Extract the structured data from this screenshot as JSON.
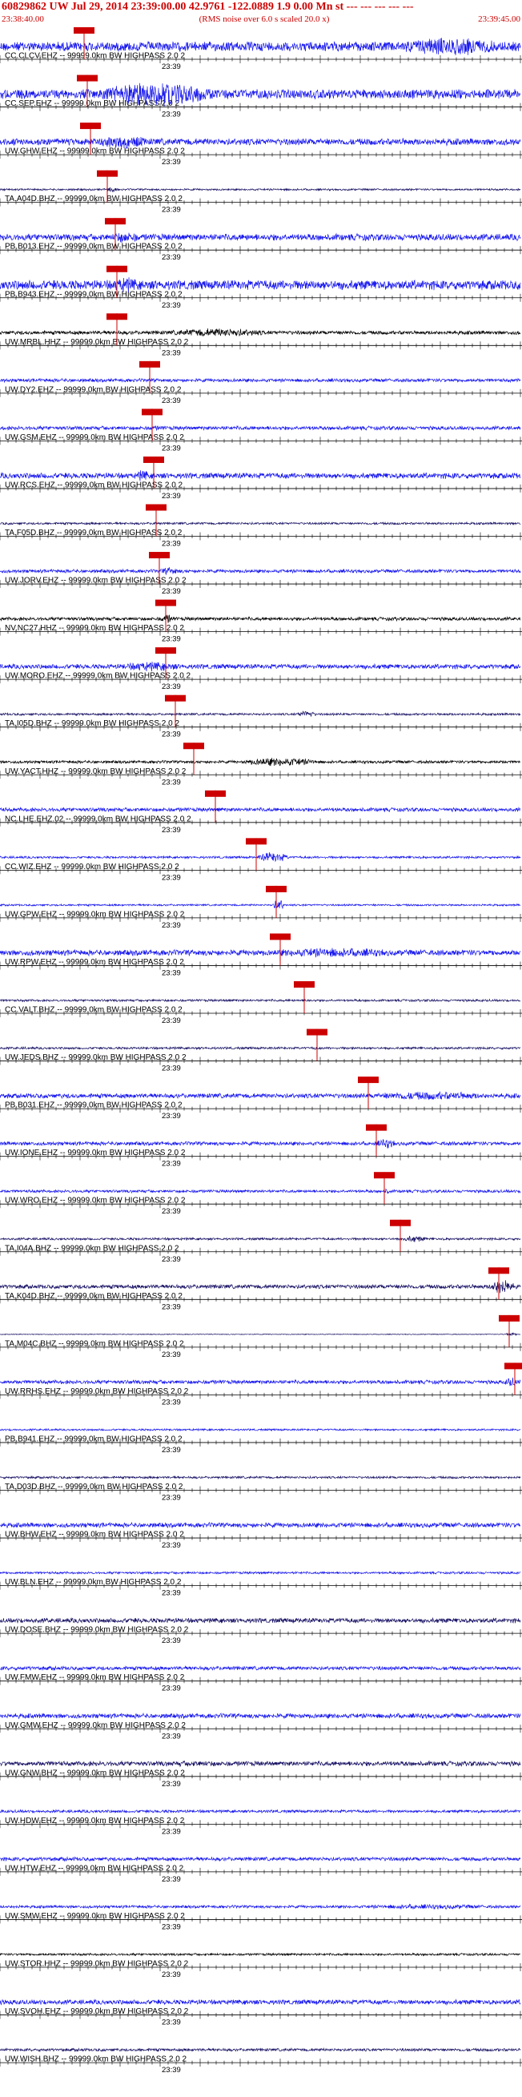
{
  "header": {
    "title": "60829862 UW Jul 29, 2014 23:39:00.00   42.9761 -122.0889  1.9 0.00 Mn st --- --- --- --- ---",
    "subtitle": "(RMS noise over 6.0 s scaled 20.0 x)",
    "start_time": "23:38:40.00",
    "end_time": "23:39:45.00"
  },
  "tick_label": "23:39",
  "colors": {
    "title": "#cc0000",
    "blue_trace": "#1a1aee",
    "navy_trace": "#1a1466",
    "black_trace": "#000000",
    "pick_box": "#cc0000",
    "axis": "#000000"
  },
  "chart_data": {
    "type": "seismogram",
    "x_unit": "time (UTC)",
    "xlim": [
      "23:38:40.00",
      "23:39:45.00"
    ],
    "channels": [
      {
        "label": "CC.CLCV.EHZ -- 99999.0km BW  HIGHPASS  2.0  2",
        "color": "blue",
        "pick": "23:38:50.5",
        "amp": 0.5,
        "burst": {
          "s": "23:39:30",
          "e": "23:39:45",
          "a": 0.95
        }
      },
      {
        "label": "CC.SEP.EHZ -- 99999.0km BW  HIGHPASS  2.0  2",
        "color": "blue",
        "pick": "23:38:50.9",
        "amp": 0.5,
        "burst": {
          "s": "23:38:52",
          "e": "23:39:10",
          "a": 1.3
        }
      },
      {
        "label": "UW.GHW.EHZ -- 99999.0km BW  HIGHPASS  2.0  2",
        "color": "blue",
        "pick": "23:38:51.3",
        "amp": 0.35,
        "burst": {
          "s": "23:38:52",
          "e": "23:39:00",
          "a": 0.7
        }
      },
      {
        "label": "TA.A04D.BHZ -- 99999.0km BW  HIGHPASS  2.0  2",
        "color": "navy",
        "pick": "23:38:53.4",
        "amp": 0.1,
        "burst": {
          "s": "23:38:53",
          "e": "23:38:55",
          "a": 0.3
        }
      },
      {
        "label": "PB.B013.EHZ -- 99999.0km BW  HIGHPASS  2.0  2",
        "color": "blue",
        "pick": "23:38:54.4",
        "amp": 0.35,
        "burst": {
          "s": "23:38:54",
          "e": "23:38:58",
          "a": 0.6
        }
      },
      {
        "label": "PB.B943.EHZ -- 99999.0km BW  HIGHPASS  2.0  2",
        "color": "blue",
        "pick": "23:38:54.6",
        "amp": 0.5,
        "burst": {
          "s": "23:38:54",
          "e": "23:38:58",
          "a": 0.8
        }
      },
      {
        "label": "UW.MRBL.HHZ -- 99999.0km BW  HIGHPASS  2.0  2",
        "color": "black",
        "pick": "23:38:54.6",
        "amp": 0.2,
        "burst": {
          "s": "23:39:01",
          "e": "23:39:16",
          "a": 0.45
        }
      },
      {
        "label": "UW.DY2.EHZ -- 99999.0km BW  HIGHPASS  2.0  2",
        "color": "blue",
        "pick": "23:38:58.7",
        "amp": 0.18,
        "burst": {
          "s": "23:38:59",
          "e": "23:39:00",
          "a": 0.2
        }
      },
      {
        "label": "UW.GSM.EHZ -- 99999.0km BW  HIGHPASS  2.0  2",
        "color": "blue",
        "pick": "23:38:59.0",
        "amp": 0.2,
        "burst": {
          "s": "23:38:59",
          "e": "23:39:01",
          "a": 0.25
        }
      },
      {
        "label": "UW.RCS.EHZ -- 99999.0km BW  HIGHPASS  2.0  2",
        "color": "blue",
        "pick": "23:38:59.2",
        "amp": 0.3,
        "burst": {
          "s": "23:38:57",
          "e": "23:38:59",
          "a": 0.6
        }
      },
      {
        "label": "TA.F05D.BHZ -- 99999.0km BW  HIGHPASS  2.0  2",
        "color": "navy",
        "pick": "23:38:59.5",
        "amp": 0.12,
        "burst": {
          "s": "23:38:59",
          "e": "23:39:00",
          "a": 0.2
        }
      },
      {
        "label": "UW.JORV.EHZ -- 99999.0km BW  HIGHPASS  2.0  2",
        "color": "blue",
        "pick": "23:38:59.9",
        "amp": 0.18,
        "burst": {
          "s": "23:39:00",
          "e": "23:39:03",
          "a": 0.4
        }
      },
      {
        "label": "NV.NC27.HHZ -- 99999.0km BW  HIGHPASS  2.0  2",
        "color": "black",
        "pick": "23:39:00.7",
        "amp": 0.18,
        "burst": {
          "s": "23:39:00",
          "e": "23:39:02",
          "a": 0.5
        }
      },
      {
        "label": "UW.MORO.EHZ -- 99999.0km BW  HIGHPASS  2.0  2",
        "color": "blue",
        "pick": "23:39:00.7",
        "amp": 0.25,
        "burst": {
          "s": "23:38:55",
          "e": "23:39:04",
          "a": 0.5
        }
      },
      {
        "label": "TA.I05D.BHZ -- 99999.0km BW  HIGHPASS  2.0  2",
        "color": "navy",
        "pick": "23:39:01.9",
        "amp": 0.12,
        "burst": {
          "s": "23:39:17",
          "e": "23:39:20",
          "a": 0.4
        }
      },
      {
        "label": "UW.YACT.HHZ -- 99999.0km BW  HIGHPASS  2.0  2",
        "color": "black",
        "pick": "23:39:04.2",
        "amp": 0.15,
        "burst": {
          "s": "23:39:10",
          "e": "23:39:22",
          "a": 0.45
        }
      },
      {
        "label": "NC.LHE.EHZ.02 -- 99999.0km BW  HIGHPASS  2.0  2",
        "color": "blue",
        "pick": "23:39:06.9",
        "amp": 0.2,
        "burst": {
          "s": "23:39:07",
          "e": "23:39:08",
          "a": 0.3
        }
      },
      {
        "label": "CC.WIZ.EHZ -- 99999.0km BW  HIGHPASS  2.0  2",
        "color": "blue",
        "pick": "23:39:12.0",
        "amp": 0.12,
        "burst": {
          "s": "23:39:12",
          "e": "23:39:17",
          "a": 0.55
        }
      },
      {
        "label": "UW.GPW.EHZ -- 99999.0km BW  HIGHPASS  2.0  2",
        "color": "blue",
        "pick": "23:39:14.5",
        "amp": 0.1,
        "burst": {
          "s": "23:39:14",
          "e": "23:39:16",
          "a": 0.6
        }
      },
      {
        "label": "UW.RPW.EHZ -- 99999.0km BW  HIGHPASS  2.0  2",
        "color": "blue",
        "pick": "23:39:15.0",
        "amp": 0.3,
        "burst": {
          "s": "23:39:14",
          "e": "23:39:32",
          "a": 0.5
        }
      },
      {
        "label": "CC.VALT.BHZ -- 99999.0km BW  HIGHPASS  2.0  2",
        "color": "navy",
        "pick": "23:39:18.0",
        "amp": 0.12,
        "burst": {
          "s": "23:39:18",
          "e": "23:39:19",
          "a": 0.2
        }
      },
      {
        "label": "UW.JEDS.BHZ -- 99999.0km BW  HIGHPASS  2.0  2",
        "color": "navy",
        "pick": "23:39:19.6",
        "amp": 0.12,
        "burst": {
          "s": "23:39:19",
          "e": "23:39:20",
          "a": 0.2
        }
      },
      {
        "label": "PB.B031.EHZ -- 99999.0km BW  HIGHPASS  2.0  2",
        "color": "blue",
        "pick": "23:39:26.0",
        "amp": 0.25,
        "burst": {
          "s": "23:39:26",
          "e": "23:39:44",
          "a": 0.45
        }
      },
      {
        "label": "UW.IONE.EHZ -- 99999.0km BW  HIGHPASS  2.0  2",
        "color": "blue",
        "pick": "23:39:27.0",
        "amp": 0.2,
        "burst": {
          "s": "23:39:27",
          "e": "23:39:30",
          "a": 0.5
        }
      },
      {
        "label": "UW.WRO.EHZ -- 99999.0km BW  HIGHPASS  2.0  2",
        "color": "blue",
        "pick": "23:39:28.0",
        "amp": 0.15,
        "burst": {
          "s": "23:39:28",
          "e": "23:39:29",
          "a": 0.3
        }
      },
      {
        "label": "TA.I04A.BHZ -- 99999.0km BW  HIGHPASS  2.0  2",
        "color": "navy",
        "pick": "23:39:30.0",
        "amp": 0.12,
        "burst": {
          "s": "23:39:30",
          "e": "23:39:34",
          "a": 0.35
        }
      },
      {
        "label": "TA.K04D.BHZ -- 99999.0km BW  HIGHPASS  2.0  2",
        "color": "navy",
        "pick": "23:39:42.3",
        "amp": 0.22,
        "burst": {
          "s": "23:39:41",
          "e": "23:39:45",
          "a": 0.8
        }
      },
      {
        "label": "TA.M04C.BHZ -- 99999.0km BW  HIGHPASS  2.0  2",
        "color": "navy",
        "pick": "23:39:43.6",
        "amp": 0.04,
        "burst": {
          "s": "23:39:43",
          "e": "23:39:45",
          "a": 0.2
        }
      },
      {
        "label": "UW.RRHS.EHZ -- 99999.0km BW  HIGHPASS  2.0  2",
        "color": "blue",
        "pick": "23:39:44.3",
        "amp": 0.2,
        "burst": {
          "s": "23:39:43",
          "e": "23:39:45",
          "a": 0.5
        }
      },
      {
        "label": "PB.B941.EHZ -- 99999.0km BW  HIGHPASS  2.0  2",
        "color": "blue",
        "pick": null,
        "amp": 0.1,
        "burst": null
      },
      {
        "label": "TA.D03D.BHZ -- 99999.0km BW  HIGHPASS  2.0  2",
        "color": "navy",
        "pick": null,
        "amp": 0.12,
        "burst": null
      },
      {
        "label": "UW.BHW.EHZ -- 99999.0km BW  HIGHPASS  2.0  2",
        "color": "blue",
        "pick": null,
        "amp": 0.25,
        "burst": null
      },
      {
        "label": "UW.BLN.EHZ -- 99999.0km BW  HIGHPASS  2.0  2",
        "color": "blue",
        "pick": null,
        "amp": 0.12,
        "burst": null
      },
      {
        "label": "UW.DOSE.BHZ -- 99999.0km BW  HIGHPASS  2.0  2",
        "color": "navy",
        "pick": null,
        "amp": 0.25,
        "burst": null
      },
      {
        "label": "UW.FMW.EHZ -- 99999.0km BW  HIGHPASS  2.0  2",
        "color": "blue",
        "pick": null,
        "amp": 0.2,
        "burst": null
      },
      {
        "label": "UW.GMW.EHZ -- 99999.0km BW  HIGHPASS  2.0  2",
        "color": "blue",
        "pick": null,
        "amp": 0.25,
        "burst": null
      },
      {
        "label": "UW.GNW.BHZ -- 99999.0km BW  HIGHPASS  2.0  2",
        "color": "navy",
        "pick": null,
        "amp": 0.25,
        "burst": {
          "s": "23:39:00",
          "e": "23:39:10",
          "a": 0.3
        }
      },
      {
        "label": "UW.HDW.EHZ -- 99999.0km BW  HIGHPASS  2.0  2",
        "color": "blue",
        "pick": null,
        "amp": 0.15,
        "burst": null
      },
      {
        "label": "UW.HTW.EHZ -- 99999.0km BW  HIGHPASS  2.0  2",
        "color": "blue",
        "pick": null,
        "amp": 0.2,
        "burst": null
      },
      {
        "label": "UW.SMW.EHZ -- 99999.0km BW  HIGHPASS  2.0  2",
        "color": "blue",
        "pick": null,
        "amp": 0.15,
        "burst": {
          "s": "23:39:25",
          "e": "23:39:45",
          "a": 0.25
        }
      },
      {
        "label": "UW.STOR.HHZ -- 99999.0km BW  HIGHPASS  2.0  2",
        "color": "black",
        "pick": null,
        "amp": 0.12,
        "burst": null
      },
      {
        "label": "UW.SVOH.EHZ -- 99999.0km BW  HIGHPASS  2.0  2",
        "color": "blue",
        "pick": null,
        "amp": 0.25,
        "burst": null
      },
      {
        "label": "UW.WISH.BHZ -- 99999.0km BW  HIGHPASS  2.0  2",
        "color": "navy",
        "pick": null,
        "amp": 0.15,
        "burst": null
      }
    ]
  }
}
